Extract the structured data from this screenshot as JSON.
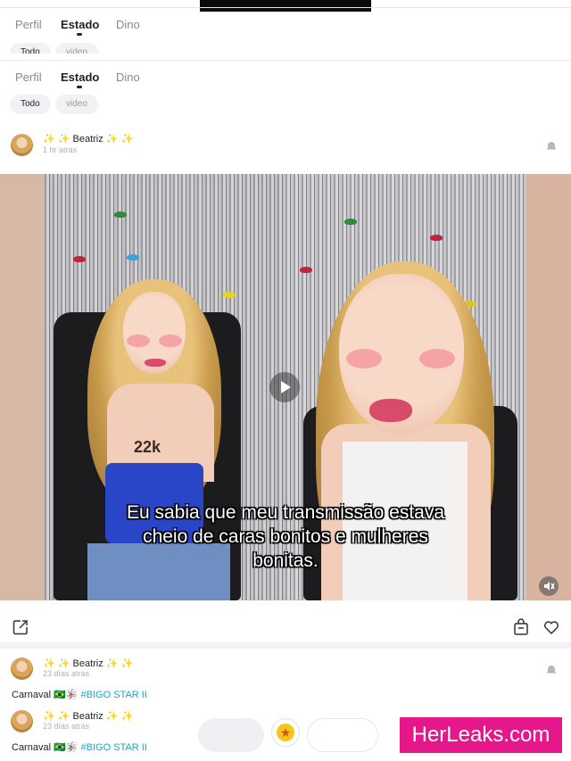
{
  "tabs": [
    {
      "label": "Perfil"
    },
    {
      "label": "Estado",
      "active": true
    },
    {
      "label": "Dino"
    }
  ],
  "filters": [
    {
      "label": "Todo",
      "selected": true
    },
    {
      "label": "video"
    }
  ],
  "post": {
    "author": "✨ ✨ Beatriz ✨ ✨",
    "time": "1 hr atrás",
    "caption": "Eu sabia que meu transmissão estava cheio de caras bonitos e mulheres bonitas.",
    "watermark_21k": "22k"
  },
  "feed": [
    {
      "author": "✨ ✨ Beatriz ✨ ✨",
      "time": "23 días atrás",
      "text": "Carnaval 🇧🇷🪅",
      "hashtag": "#BIGO STAR II"
    },
    {
      "author": "✨ ✨ Beatriz ✨ ✨",
      "time": "23 días atrás",
      "text": "Carnaval 🇧🇷🪅",
      "hashtag": "#BIGO STAR II"
    }
  ],
  "branding": {
    "watermark": "HerLeaks.com",
    "watermark_color": "#e5178a",
    "hashtag_color": "#1aa6c9",
    "star_color": "#f5c518"
  },
  "icons": [
    "share-icon",
    "bag-icon",
    "heart-icon",
    "bell-icon",
    "play-icon",
    "mute-icon",
    "star-icon"
  ]
}
